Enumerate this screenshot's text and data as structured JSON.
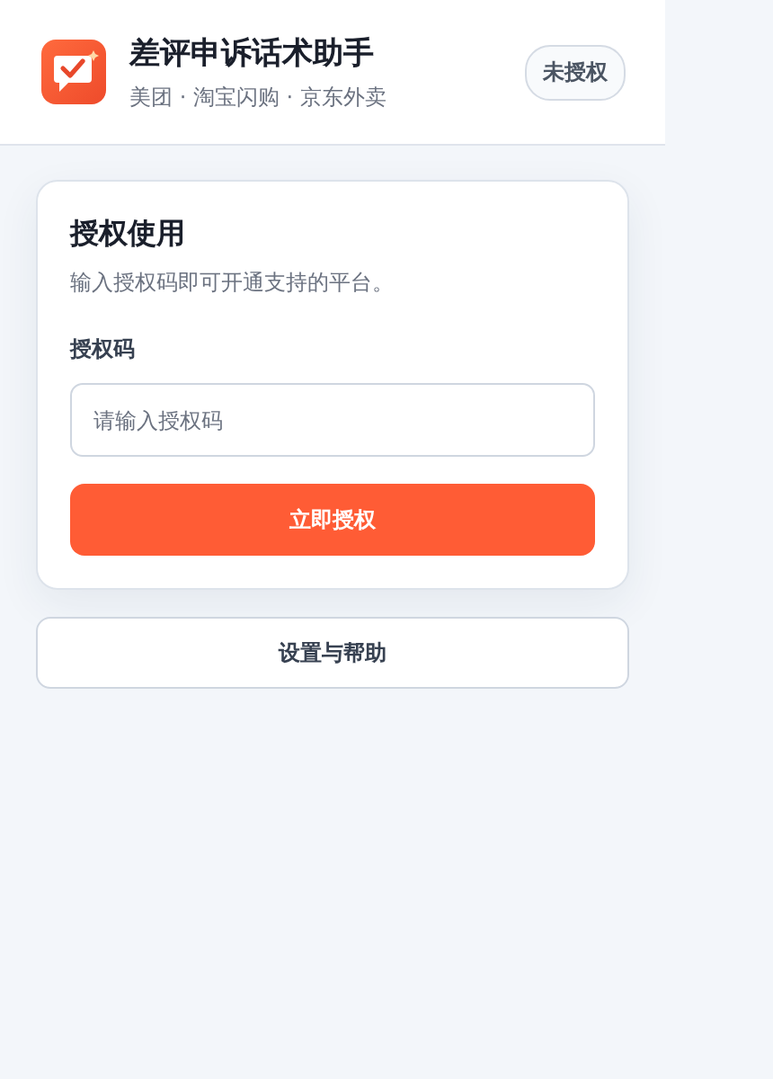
{
  "header": {
    "title": "差评申诉话术助手",
    "subtitle": "美团 · 淘宝闪购 · 京东外卖",
    "status_badge": "未授权"
  },
  "auth_card": {
    "title": "授权使用",
    "description": "输入授权码即可开通支持的平台。",
    "field_label": "授权码",
    "placeholder": "请输入授权码",
    "submit_button": "立即授权"
  },
  "settings_button": "设置与帮助"
}
